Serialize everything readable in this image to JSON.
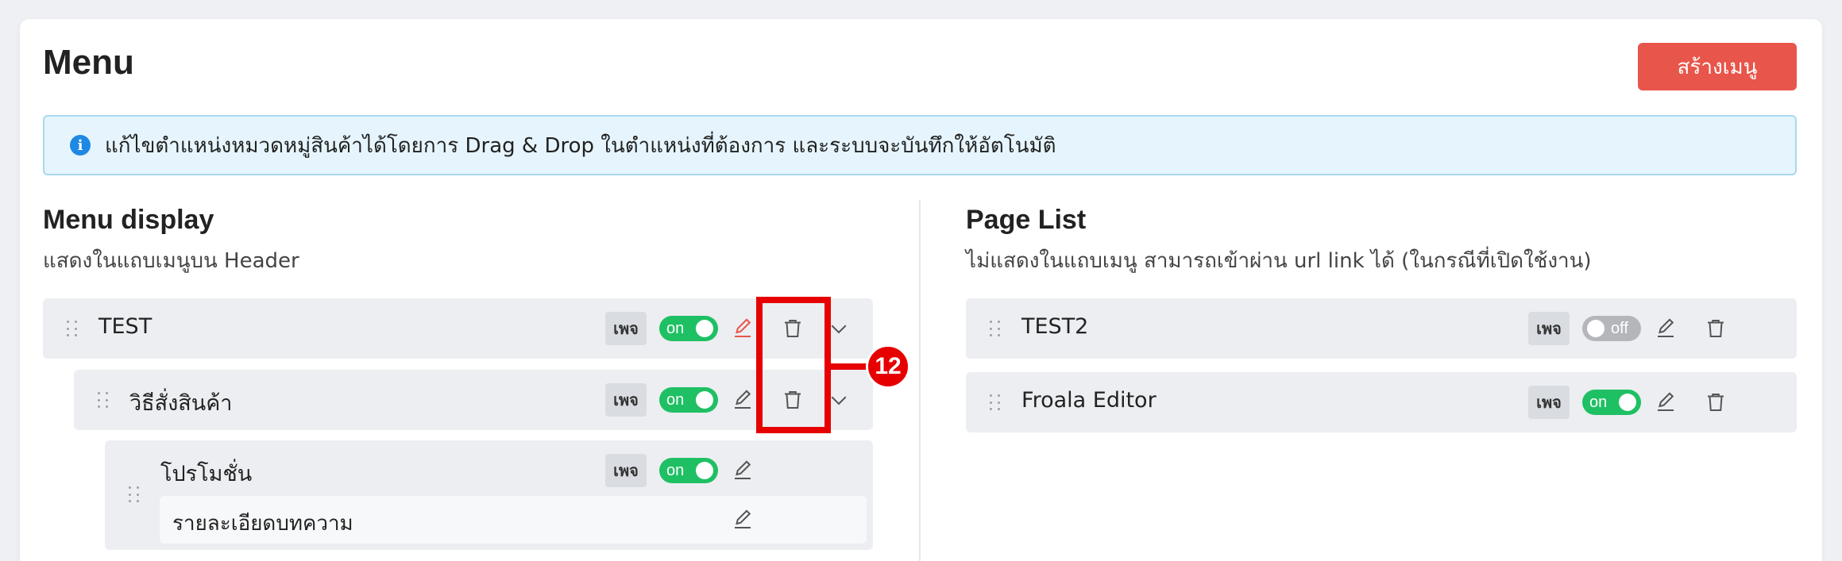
{
  "header": {
    "title": "Menu",
    "create_button": "สร้างเมนู"
  },
  "info": {
    "icon": "i",
    "text": "แก้ไขตำแหน่งหมวดหมู่สินค้าได้โดยการ Drag & Drop ในตำแหน่งที่ต้องการ และระบบจะบันทึกให้อัตโนมัติ"
  },
  "menu_display": {
    "title": "Menu display",
    "subtitle": "แสดงในแถบเมนูบน Header",
    "items": [
      {
        "label": "TEST",
        "badge": "เพจ",
        "toggle": "on"
      },
      {
        "label": "วิธีสั่งสินค้า",
        "badge": "เพจ",
        "toggle": "on"
      },
      {
        "label": "โปรโมชั่น",
        "badge": "เพจ",
        "toggle": "on"
      },
      {
        "label": "รายละเอียดบทความ"
      }
    ]
  },
  "page_list": {
    "title": "Page List",
    "subtitle": "ไม่แสดงในแถบเมนู สามารถเข้าผ่าน url link ได้ (ในกรณีที่เปิดใช้งาน)",
    "items": [
      {
        "label": "TEST2",
        "badge": "เพจ",
        "toggle": "off"
      },
      {
        "label": "Froala Editor",
        "badge": "เพจ",
        "toggle": "on"
      }
    ]
  },
  "annotation": {
    "number": "12"
  },
  "colors": {
    "accent": "#e8554a",
    "toggle_on": "#1fc063",
    "toggle_off": "#b4b6bb",
    "annotation": "#e60000",
    "edit_highlight": "#e8554a"
  }
}
